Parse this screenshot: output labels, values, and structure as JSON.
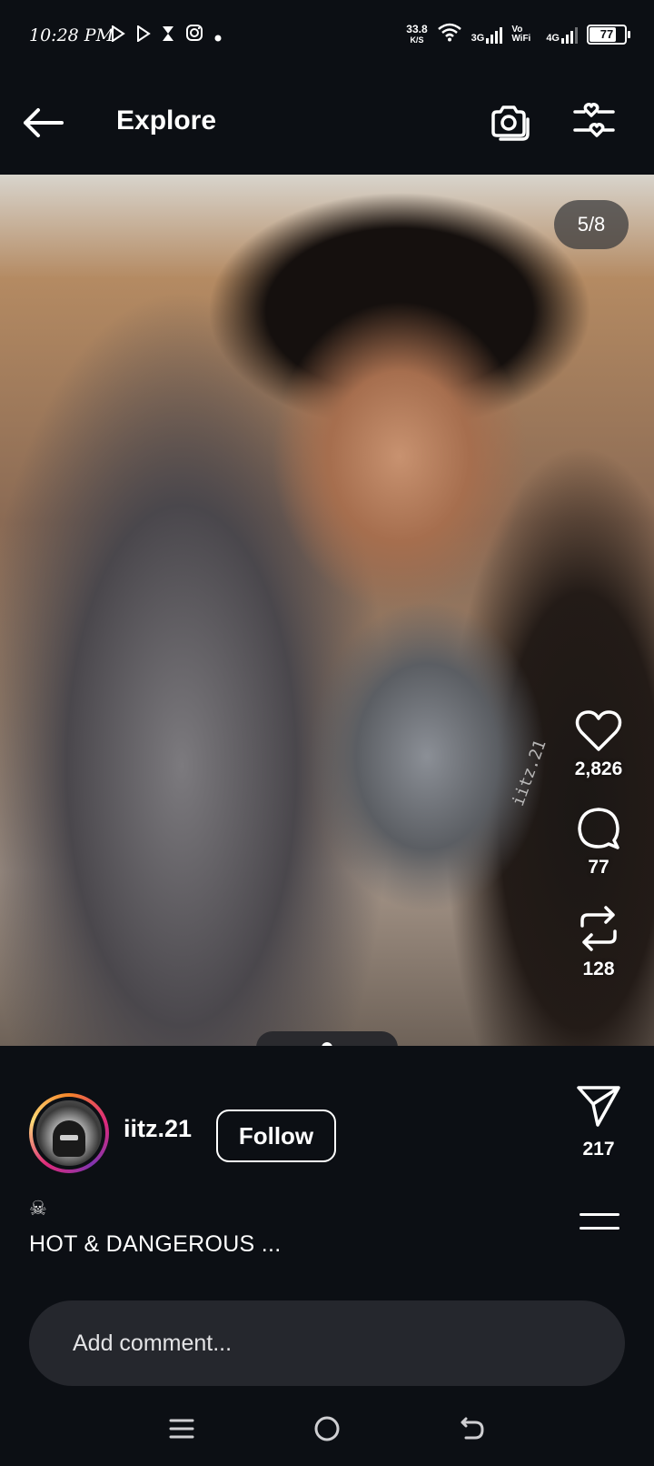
{
  "status_bar": {
    "time": "10:28 PM",
    "net_speed": "33.8",
    "net_speed_unit": "K/S",
    "net_3g": "3G",
    "net_vowifi": "Vo WiFi",
    "net_4g": "4G",
    "battery": "77"
  },
  "header": {
    "title": "Explore"
  },
  "post": {
    "photo_counter": "5/8",
    "watermark": "iitz.21",
    "likes": "2,826",
    "comments": "77",
    "reposts": "128",
    "shares": "217",
    "carousel": {
      "total_dots": 5,
      "active_index": 2
    },
    "username": "iitz.21",
    "follow_label": "Follow",
    "caption_emoji": "☠",
    "caption": "HOT & DANGEROUS ..."
  },
  "comment": {
    "placeholder": "Add comment..."
  },
  "colors": {
    "background": "#0c0f14",
    "input_bg": "#25272d",
    "ring": [
      "#f58529",
      "#dd2a7b",
      "#8134af"
    ]
  }
}
